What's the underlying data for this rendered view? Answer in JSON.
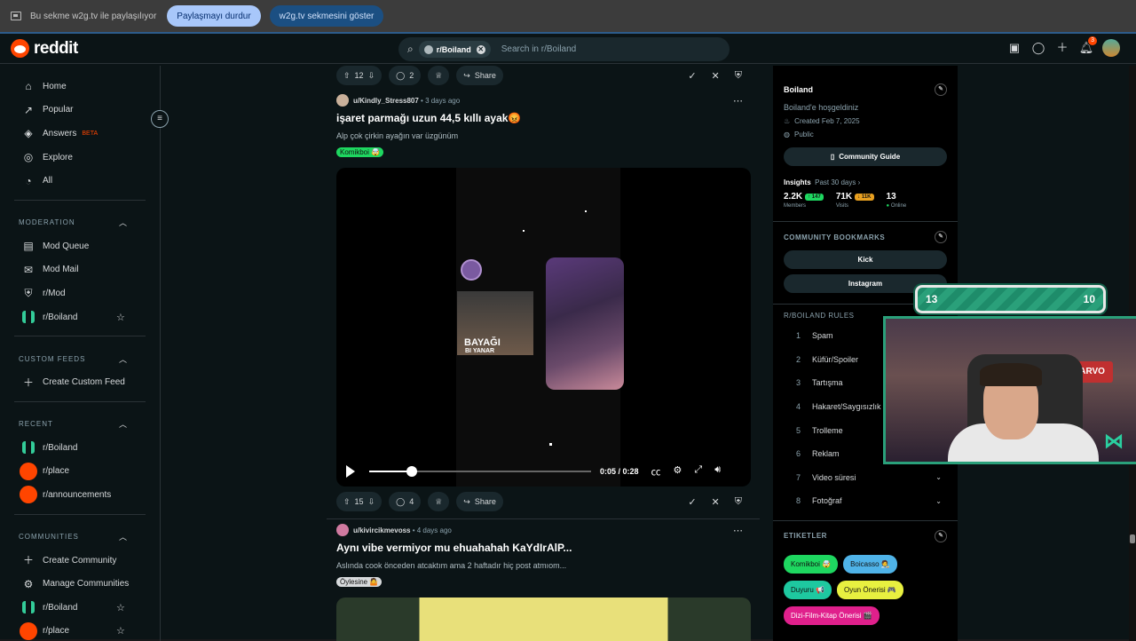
{
  "share_bar": {
    "message": "Bu sekme w2g.tv ile paylaşılıyor",
    "stop_label": "Paylaşmayı durdur",
    "show_label": "w2g.tv sekmesini göster"
  },
  "header": {
    "logo": "reddit",
    "search_chip": "r/Boiland",
    "search_placeholder": "Search in r/Boiland",
    "notification_count": "3"
  },
  "sidebar": {
    "main": [
      {
        "label": "Home",
        "icon": "home-icon"
      },
      {
        "label": "Popular",
        "icon": "popular-icon"
      },
      {
        "label": "Answers",
        "badge": "BETA",
        "icon": "answers-icon"
      },
      {
        "label": "Explore",
        "icon": "explore-icon"
      },
      {
        "label": "All",
        "icon": "all-icon"
      }
    ],
    "moderation": {
      "title": "MODERATION",
      "items": [
        "Mod Queue",
        "Mod Mail",
        "r/Mod",
        "r/Boiland"
      ]
    },
    "custom_feeds": {
      "title": "CUSTOM FEEDS",
      "create": "Create Custom Feed"
    },
    "recent": {
      "title": "RECENT",
      "items": [
        "r/Boiland",
        "r/place",
        "r/announcements"
      ]
    },
    "communities": {
      "title": "COMMUNITIES",
      "items": [
        "Create Community",
        "Manage Communities",
        "r/Boiland",
        "r/place"
      ]
    }
  },
  "feed": {
    "top_actions": {
      "upvotes": "12",
      "comments": "2",
      "share": "Share"
    },
    "post1": {
      "author": "u/Kindly_Stress807",
      "age": "3 days ago",
      "title": "işaret parmağı uzun 44,5 kıllı ayak😡",
      "body": "Alp çok çirkin ayağın var üzgünüm",
      "flair": "Komikboi 🤯",
      "video_overlay_1": "BAYAĞI",
      "video_overlay_2": "BI YANAR",
      "time": "0:05 / 0:28",
      "progress": 0.19,
      "upvotes": "15",
      "comments": "4",
      "share": "Share"
    },
    "post2": {
      "author": "u/kivircikmevoss",
      "age": "4 days ago",
      "title": "Aynı vibe vermiyor mu ehuahahah KaYdIrAlP...",
      "body": "Aslında cook önceden atcaktım ama 2 haftadır hiç post atmıom...",
      "flair": "Öylesine 🤷"
    }
  },
  "right": {
    "name": "Boiland",
    "description": "Boiland'e hoşgeldiniz",
    "created": "Created Feb 7, 2025",
    "visibility": "Public",
    "guide_btn": "Community Guide",
    "insights_label": "Insights",
    "insights_range": "Past 30 days ›",
    "members": "2.2K",
    "members_delta": "↑ 147",
    "members_label": "Members",
    "visits": "71K",
    "visits_delta": "↓ 11K",
    "visits_label": "Visits",
    "online": "13",
    "online_label": "Online",
    "bookmarks_title": "COMMUNITY BOOKMARKS",
    "bookmarks": [
      "Kick",
      "Instagram"
    ],
    "rules_title": "R/BOILAND RULES",
    "rules": [
      "Spam",
      "Küfür/Spoiler",
      "Tartışma",
      "Hakaret/Saygısızlık",
      "Trolleme",
      "Reklam",
      "Video süresi",
      "Fotoğraf"
    ],
    "tags_title": "ETIKETLER",
    "tags": [
      {
        "label": "Komikboi 🤯",
        "color": "#1ed760"
      },
      {
        "label": "Boicasso 🧑‍🎨",
        "color": "#4fb3e8"
      },
      {
        "label": "Duyuru 📢",
        "color": "#1ec8a0"
      },
      {
        "label": "Oyun Önerisi 🎮",
        "color": "#e8f040"
      },
      {
        "label": "Dizi-Film-Kitap Önerisi 🎬",
        "color": "#e0208c"
      }
    ]
  },
  "overlay": {
    "score_left": "13",
    "score_right": "10",
    "cam_sign": "HARVO"
  }
}
